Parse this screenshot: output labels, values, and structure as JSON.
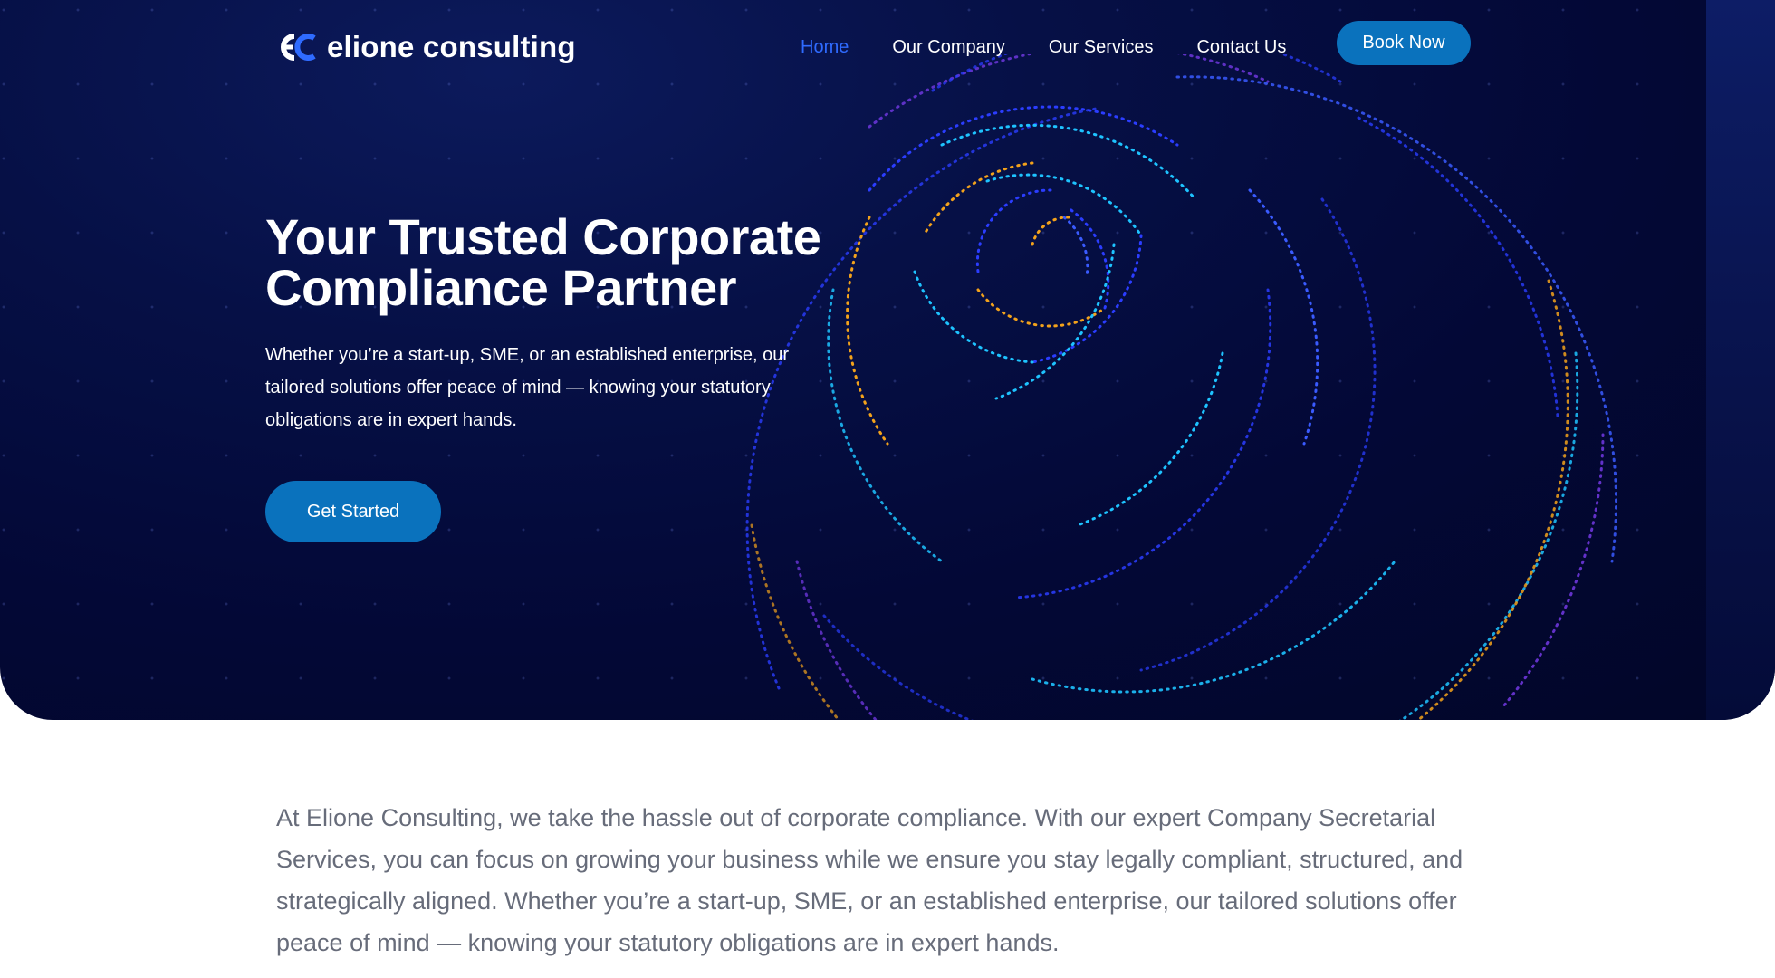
{
  "header": {
    "logo_text": "elione consulting",
    "logo_mark_letters": "eC",
    "nav": [
      {
        "label": "Home",
        "active": true
      },
      {
        "label": "Our Company",
        "active": false
      },
      {
        "label": "Our Services",
        "active": false
      },
      {
        "label": "Contact Us",
        "active": false
      }
    ],
    "book_label": "Book Now"
  },
  "hero": {
    "title_line1": "Your Trusted Corporate",
    "title_line2": "Compliance Partner",
    "subtitle": "Whether you’re a start-up, SME, or an established enterprise, our tailored solutions offer peace of mind — knowing your statutory obligations are in expert hands.",
    "cta_label": "Get Started"
  },
  "intro": {
    "text": "At Elione Consulting, we take the hassle out of corporate compliance. With our expert Company Secretarial Services, you can focus on growing your business while we ensure you stay legally compliant, structured, and strategically aligned. Whether you’re a start-up, SME, or an established enterprise, our tailored solutions offer peace of mind — knowing your statutory obligations are in expert hands."
  },
  "colors": {
    "hero_bg": "#030836",
    "accent_button": "#0a72bd",
    "nav_active": "#2f6bff",
    "body_text": "#676c7a",
    "orbit_colors": [
      "#2b3dff",
      "#1ec3ff",
      "#f3a21b",
      "#7b3cf0",
      "#3a5bff"
    ]
  },
  "icons": {
    "logo": "elione-logo-mark",
    "hero_graphic": "dotted-orbit-sphere"
  }
}
